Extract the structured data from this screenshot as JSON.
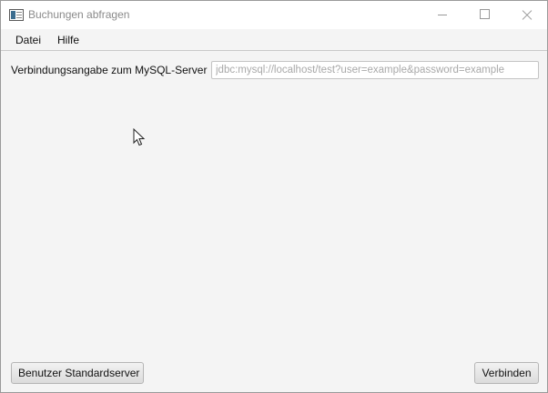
{
  "window": {
    "title": "Buchungen abfragen"
  },
  "menubar": {
    "items": [
      {
        "label": "Datei"
      },
      {
        "label": "Hilfe"
      }
    ]
  },
  "connection": {
    "label": "Verbindungsangabe zum MySQL-Server",
    "value": "",
    "placeholder": "jdbc:mysql://localhost/test?user=example&password=example"
  },
  "buttons": {
    "standard_server": "Benutzer Standardserver",
    "connect": "Verbinden"
  },
  "icons": {
    "app": "application-window-icon",
    "minimize": "minimize-icon",
    "maximize": "maximize-icon",
    "close": "close-icon",
    "cursor": "mouse-pointer-icon"
  },
  "colors": {
    "background": "#f4f4f4",
    "titlebar": "#ffffff",
    "placeholder": "#a9a9a9"
  }
}
